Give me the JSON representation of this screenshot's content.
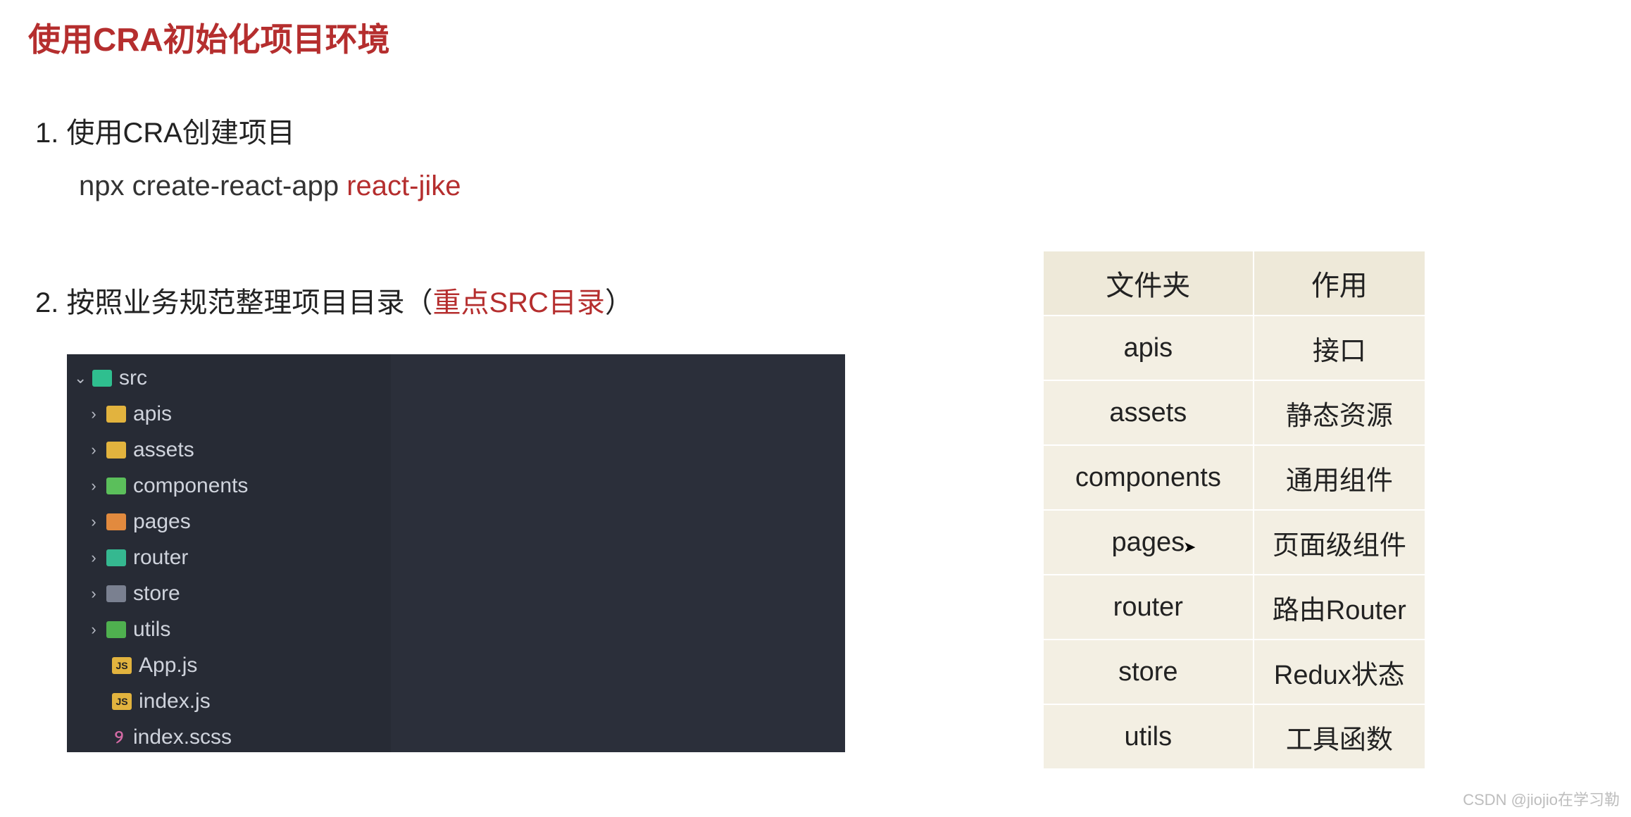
{
  "title": "使用CRA初始化项目环境",
  "section1": {
    "heading": "1. 使用CRA创建项目",
    "command_prefix": "npx  create-react-app  ",
    "command_highlight": "react-jike"
  },
  "section2": {
    "heading_prefix": "2. 按照业务规范整理项目目录（",
    "heading_highlight": "重点SRC目录",
    "heading_suffix": "）"
  },
  "file_tree": {
    "root": "src",
    "items": [
      {
        "name": "apis",
        "type": "folder",
        "color": "yellow"
      },
      {
        "name": "assets",
        "type": "folder",
        "color": "yellow"
      },
      {
        "name": "components",
        "type": "folder",
        "color": "green"
      },
      {
        "name": "pages",
        "type": "folder",
        "color": "orange"
      },
      {
        "name": "router",
        "type": "folder",
        "color": "teal2"
      },
      {
        "name": "store",
        "type": "folder",
        "color": "gray"
      },
      {
        "name": "utils",
        "type": "folder",
        "color": "green2"
      },
      {
        "name": "App.js",
        "type": "file-js"
      },
      {
        "name": "index.js",
        "type": "file-js"
      },
      {
        "name": "index.scss",
        "type": "file-scss"
      }
    ]
  },
  "table": {
    "header_folder": "文件夹",
    "header_use": "作用",
    "rows": [
      {
        "folder": "apis",
        "use": "接口"
      },
      {
        "folder": "assets",
        "use": "静态资源"
      },
      {
        "folder": "components",
        "use": "通用组件"
      },
      {
        "folder": "pages",
        "use": "页面级组件"
      },
      {
        "folder": "router",
        "use": "路由Router"
      },
      {
        "folder": "store",
        "use": "Redux状态"
      },
      {
        "folder": "utils",
        "use": "工具函数"
      }
    ]
  },
  "watermark": "CSDN @jiojio在学习勒"
}
